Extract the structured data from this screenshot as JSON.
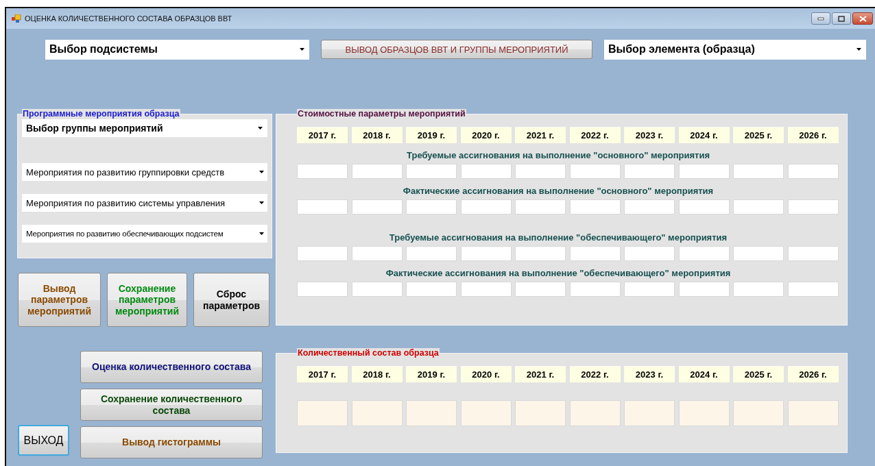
{
  "window": {
    "title": "ОЦЕНКА КОЛИЧЕСТВЕННОГО СОСТАВА ОБРАЗЦОВ ВВТ"
  },
  "top": {
    "subsystem_select": {
      "value": "Выбор подсистемы"
    },
    "output_button": "ВЫВОД ОБРАЗЦОВ ВВТ И ГРУППЫ МЕРОПРИЯТИЙ",
    "element_select": {
      "value": "Выбор элемента (образца)"
    }
  },
  "events_group": {
    "title": "Программные мероприятия образца",
    "group_select": {
      "value": "Выбор группы мероприятий"
    },
    "selects": [
      {
        "value": "Мероприятия по развитию группировки средств"
      },
      {
        "value": "Мероприятия по развитию системы управления"
      },
      {
        "value": "Мероприятия по развитию обеспечивающих подсистем"
      }
    ]
  },
  "param_buttons": [
    {
      "label": "Вывод параметров мероприятий",
      "kind": "output"
    },
    {
      "label": "Сохранение параметров мероприятий",
      "kind": "save"
    },
    {
      "label": "Сброс параметров",
      "kind": "reset"
    }
  ],
  "cost_group": {
    "title": "Стоимостные  параметры мероприятий",
    "years": [
      "2017 г.",
      "2018 г.",
      "2019 г.",
      "2020 г.",
      "2021 г.",
      "2022 г.",
      "2023 г.",
      "2024 г.",
      "2025 г.",
      "2026 г."
    ],
    "sections": [
      {
        "caption": "Требуемые ассигнования на выполнение \"основного\" мероприятия"
      },
      {
        "caption": "Фактические ассигнования на выполнение \"основного\" мероприятия"
      },
      {
        "caption": "Требуемые ассигнования на выполнение \"обеспечивающего\" мероприятия"
      },
      {
        "caption": "Фактические ассигнования на выполнение \"обеспечивающего\" мероприятия"
      }
    ]
  },
  "quantity_buttons": [
    {
      "label": "Оценка количественного состава",
      "kind": "estimate"
    },
    {
      "label": "Сохранение количественного состава",
      "kind": "save"
    },
    {
      "label": "Вывод гистограммы",
      "kind": "histogram"
    }
  ],
  "exit_button": "ВЫХОД",
  "quantity_group": {
    "title": "Количественный состав образца",
    "years": [
      "2017 г.",
      "2018 г.",
      "2019 г.",
      "2020 г.",
      "2021 г.",
      "2022 г.",
      "2023 г.",
      "2024 г.",
      "2025 г.",
      "2026 г."
    ]
  }
}
